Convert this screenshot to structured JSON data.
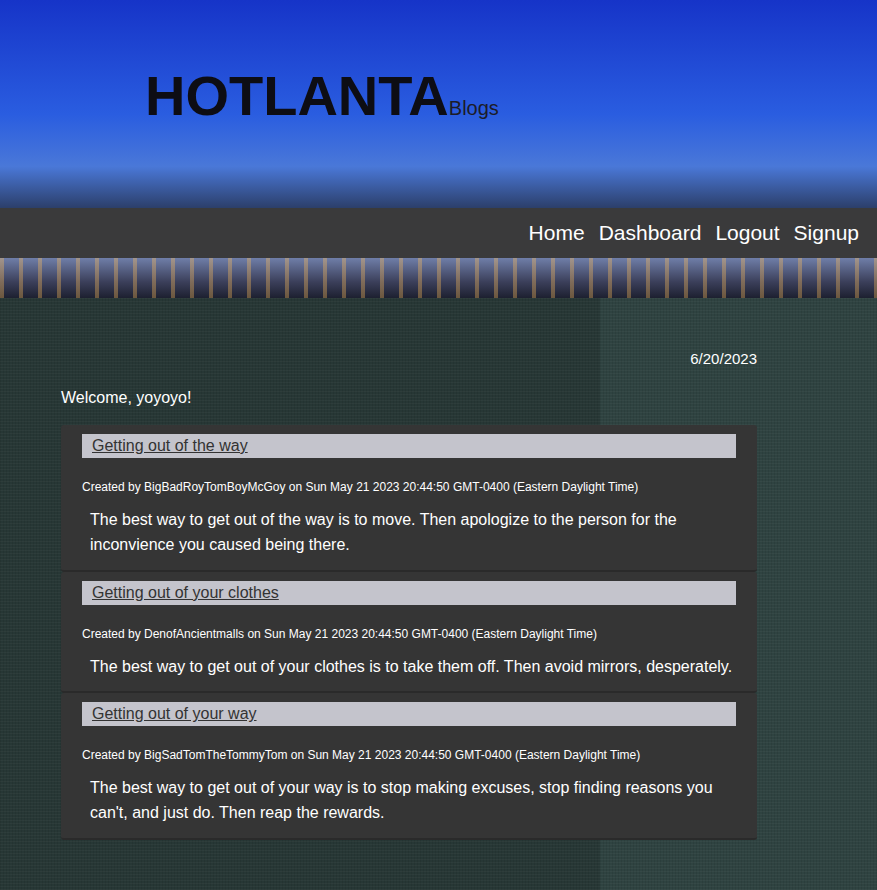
{
  "header": {
    "title": "HOTLANTA",
    "subtitle": "Blogs"
  },
  "nav": [
    {
      "label": "Home"
    },
    {
      "label": "Dashboard"
    },
    {
      "label": "Logout"
    },
    {
      "label": "Signup"
    }
  ],
  "date": "6/20/2023",
  "welcome": "Welcome, yoyoyo!",
  "posts": [
    {
      "title": "Getting out of the way",
      "meta": "Created by BigBadRoyTomBoyMcGoy on Sun May 21 2023 20:44:50 GMT-0400 (Eastern Daylight Time)",
      "body": "The best way to get out of the way is to move. Then apologize to the person for the inconvience you caused being there."
    },
    {
      "title": "Getting out of your clothes",
      "meta": "Created by DenofAncientmalls on Sun May 21 2023 20:44:50 GMT-0400 (Eastern Daylight Time)",
      "body": "The best way to get out of your clothes is to take them off. Then avoid mirrors, desperately."
    },
    {
      "title": "Getting out of your way",
      "meta": "Created by BigSadTomTheTommyTom on Sun May 21 2023 20:44:50 GMT-0400 (Eastern Daylight Time)",
      "body": "The best way to get out of your way is to stop making excuses, stop finding reasons you can't, and just do. Then reap the rewards."
    }
  ]
}
